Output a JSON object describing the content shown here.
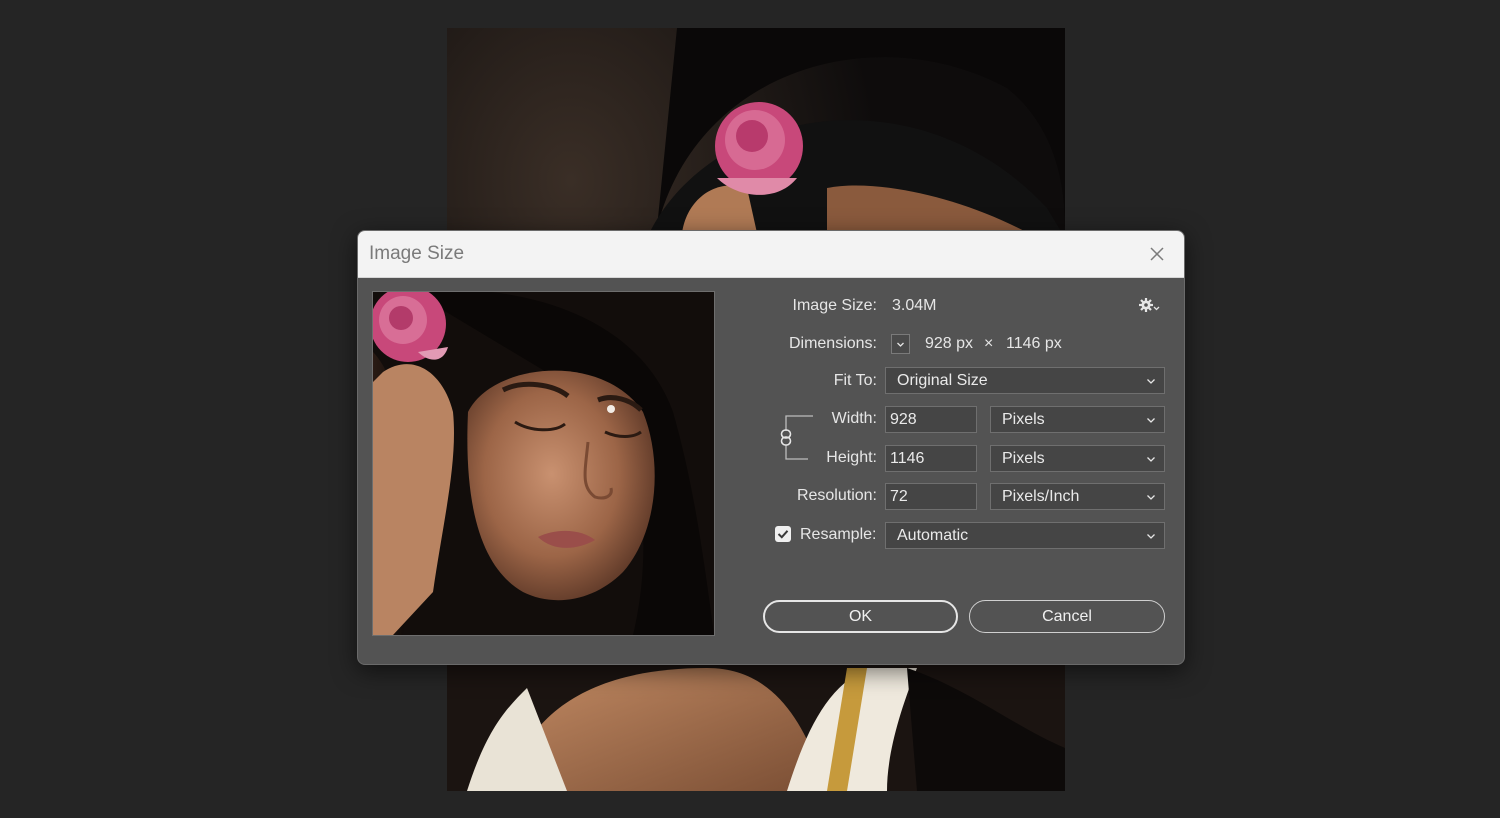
{
  "dialog": {
    "title": "Image Size",
    "close_icon": "close-icon",
    "settings_icon": "gear-icon"
  },
  "fields": {
    "image_size_label": "Image Size:",
    "image_size_value": "3.04M",
    "dimensions_label": "Dimensions:",
    "dimensions_width": "928 px",
    "dimensions_times": "×",
    "dimensions_height": "1146 px",
    "fit_to_label": "Fit To:",
    "fit_to_value": "Original Size",
    "width_label": "Width:",
    "width_value": "928",
    "width_unit": "Pixels",
    "height_label": "Height:",
    "height_value": "1146",
    "height_unit": "Pixels",
    "resolution_label": "Resolution:",
    "resolution_value": "72",
    "resolution_unit": "Pixels/Inch",
    "resample_label": "Resample:",
    "resample_checked": true,
    "resample_value": "Automatic"
  },
  "buttons": {
    "ok": "OK",
    "cancel": "Cancel"
  },
  "colors": {
    "dialog_bg": "#535353",
    "app_bg": "#252525",
    "titlebar_bg": "#f3f3f3",
    "rose": "#c8487a"
  }
}
